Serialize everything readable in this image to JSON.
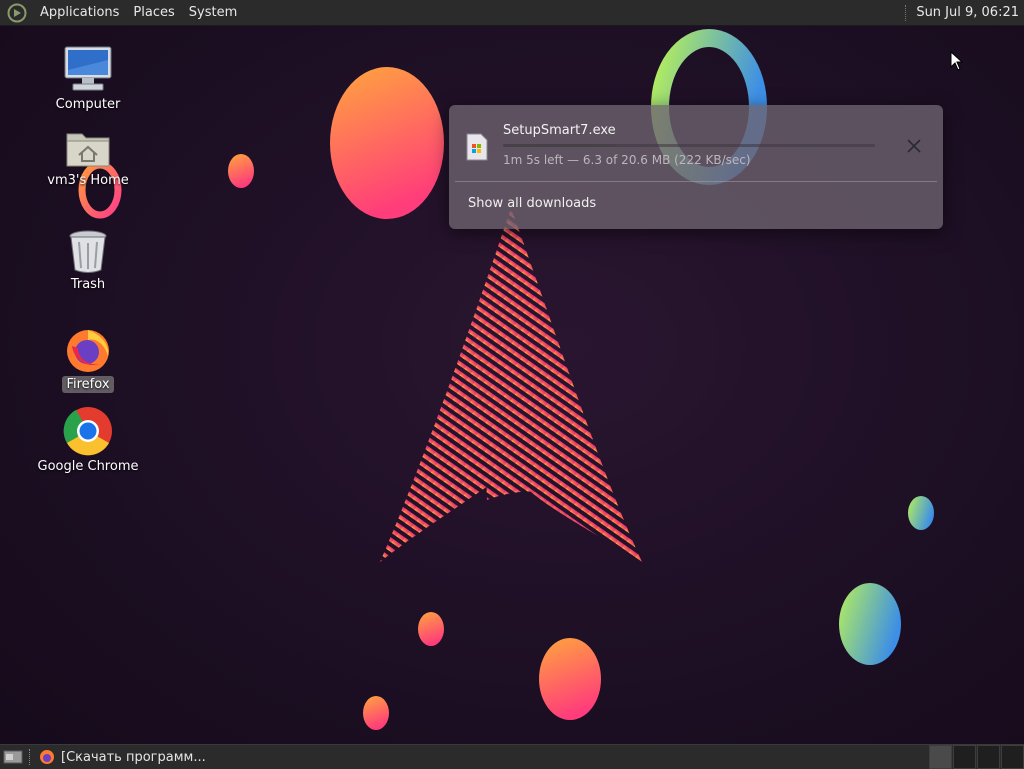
{
  "top_panel": {
    "menus": [
      "Applications",
      "Places",
      "System"
    ],
    "clock": "Sun Jul  9, 06:21"
  },
  "desktop_icons": [
    {
      "label": "Computer",
      "icon": "computer-icon"
    },
    {
      "label": "vm3's Home",
      "icon": "home-folder-icon"
    },
    {
      "label": "Trash",
      "icon": "trash-icon"
    },
    {
      "label": "Firefox",
      "icon": "firefox-icon",
      "selected": true
    },
    {
      "label": "Google Chrome",
      "icon": "chrome-icon"
    }
  ],
  "download": {
    "file_name": "SetupSmart7.exe",
    "status": "1m 5s left — 6.3 of 20.6 MB (222 KB/sec)",
    "progress": 0.306,
    "show_all": "Show all downloads"
  },
  "taskbar": {
    "task_label": "[Скачать программ..."
  },
  "colors": {
    "panel_bg": "#2b2b2b",
    "wallpaper_bg": "#1d0f24",
    "arch_logo": "#e0307a"
  }
}
